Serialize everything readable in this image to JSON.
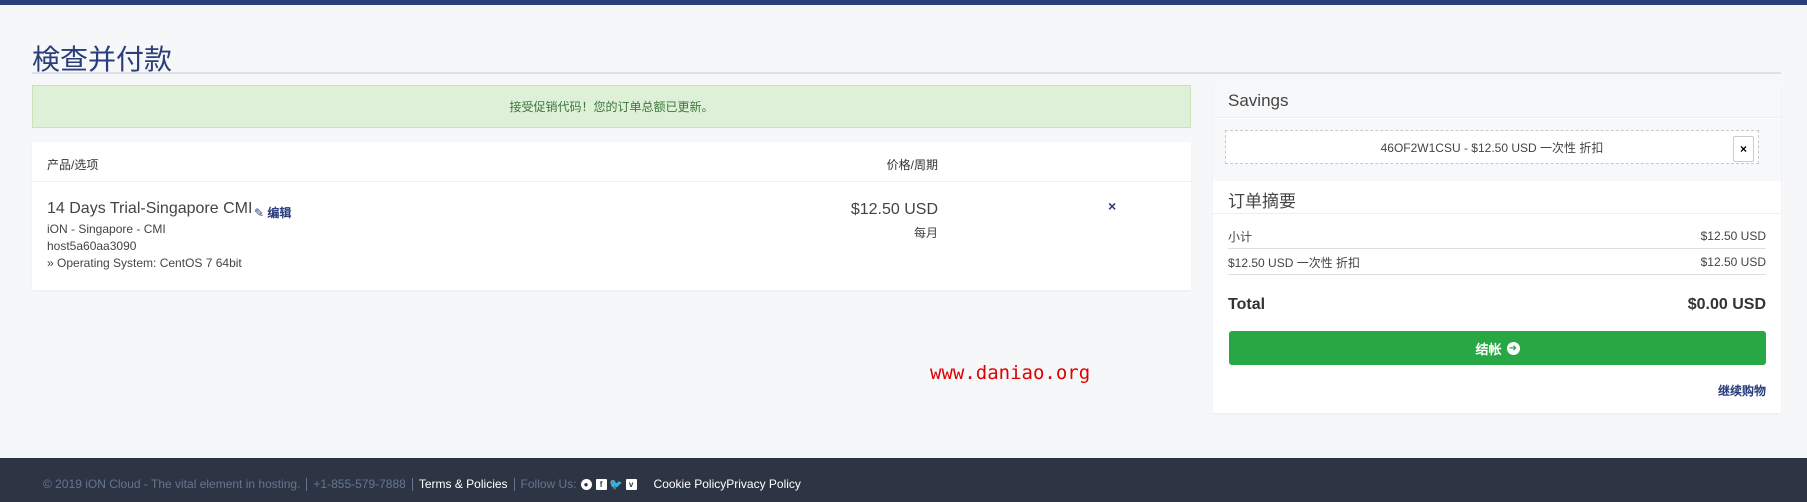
{
  "page": {
    "title": "検查并付款"
  },
  "alert": {
    "text": "接受促销代码！您的订单总额已更新。"
  },
  "cart": {
    "col_product": "产品/选项",
    "col_price": "价格/周期",
    "item": {
      "name": "14 Days Trial-Singapore CMI",
      "edit_label": "编辑",
      "lines": [
        "iON - Singapore - CMI",
        "host5a60aa3090",
        "» Operating System: CentOS 7 64bit"
      ],
      "price": "$12.50 USD",
      "cycle": "每月",
      "remove_icon": "×"
    }
  },
  "savings": {
    "title": "Savings",
    "coupon": "46OF2W1CSU - $12.50 USD 一次性 折扣",
    "remove": "×"
  },
  "summary": {
    "title": "订单摘要",
    "rows": [
      {
        "label": "小计",
        "value": "$12.50 USD"
      },
      {
        "label": "$12.50 USD 一次性 折扣",
        "value": "$12.50 USD"
      }
    ],
    "total_label": "Total",
    "total_value": "$0.00 USD",
    "checkout_label": "结帐",
    "continue_label": "继续购物"
  },
  "watermark": "www.daniao.org",
  "footer": {
    "copyright": "© 2019 iON Cloud - The vital element in hosting.",
    "phone": "+1-855-579-7888",
    "terms": "Terms & Policies",
    "follow": "Follow Us:",
    "cookie": "Cookie Policy",
    "privacy": "Privacy Policy"
  },
  "colors": {
    "brand": "#2b3d7a",
    "success": "#28a745",
    "footer_bg": "#2d3544"
  }
}
